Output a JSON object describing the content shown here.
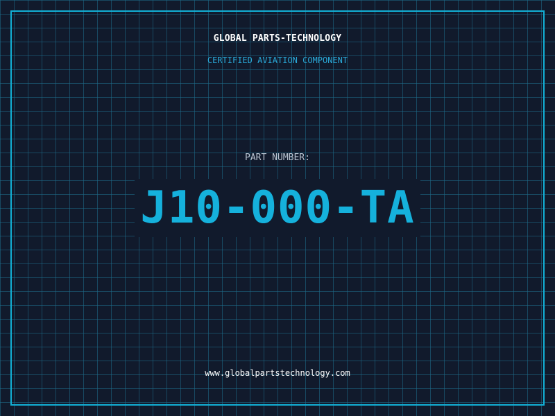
{
  "header": {
    "company": "GLOBAL PARTS-TECHNOLOGY",
    "subtitle": "CERTIFIED AVIATION COMPONENT"
  },
  "part": {
    "label": "PART NUMBER:",
    "number": "J10-000-TA"
  },
  "footer": {
    "url": "www.globalpartstechnology.com"
  },
  "colors": {
    "background": "#111a2c",
    "grid": "#1e6e8c",
    "accent": "#15b1dc",
    "subtitle": "#2aa9d8",
    "label": "#b9c3d0",
    "text": "#ffffff"
  }
}
